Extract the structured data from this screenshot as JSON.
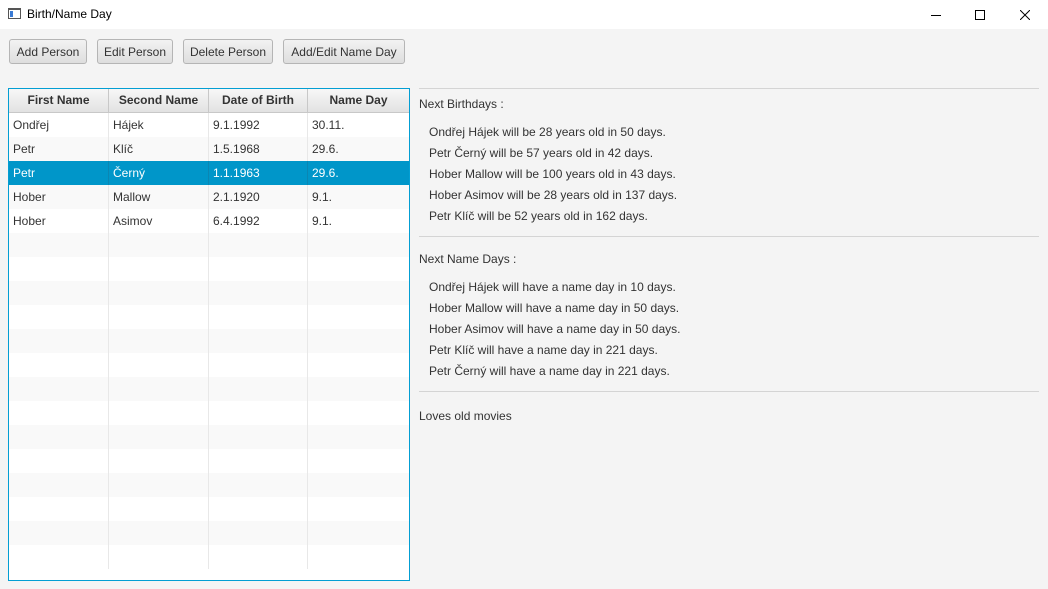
{
  "window": {
    "title": "Birth/Name Day"
  },
  "toolbar": {
    "add_person": "Add Person",
    "edit_person": "Edit Person",
    "delete_person": "Delete Person",
    "add_edit_name_day": "Add/Edit Name Day"
  },
  "table": {
    "columns": [
      "First Name",
      "Second Name",
      "Date of Birth",
      "Name Day"
    ],
    "rows": [
      [
        "Ondřej",
        "Hájek",
        "9.1.1992",
        "30.11."
      ],
      [
        "Petr",
        "Klíč",
        "1.5.1968",
        "29.6."
      ],
      [
        "Petr",
        "Černý",
        "1.1.1963",
        "29.6."
      ],
      [
        "Hober",
        "Mallow",
        "2.1.1920",
        "9.1."
      ],
      [
        "Hober",
        "Asimov",
        "6.4.1992",
        "9.1."
      ]
    ],
    "selected_row": 2
  },
  "birthdays": {
    "title": "Next Birthdays :",
    "lines": [
      "Ondřej Hájek will be 28 years old in 50 days.",
      "Petr Černý will be 57 years old in 42 days.",
      "Hober Mallow will be 100 years old in 43 days.",
      "Hober Asimov will be 28 years old in 137 days.",
      "Petr Klíč will be 52 years old in 162 days."
    ]
  },
  "namedays": {
    "title": "Next Name Days :",
    "lines": [
      "Ondřej Hájek will have a name day in 10 days.",
      "Hober Mallow will have a name day in 50 days.",
      "Hober Asimov will have a name day in 50 days.",
      "Petr Klíč will have a name day in 221 days.",
      "Petr Černý will have a name day in 221 days."
    ]
  },
  "note": {
    "text": "Loves old movies"
  },
  "colors": {
    "accent": "#0096c9",
    "border_focus": "#039ed3"
  },
  "icons": {
    "minimize": "minimize-icon",
    "maximize": "maximize-icon",
    "close": "close-icon"
  }
}
